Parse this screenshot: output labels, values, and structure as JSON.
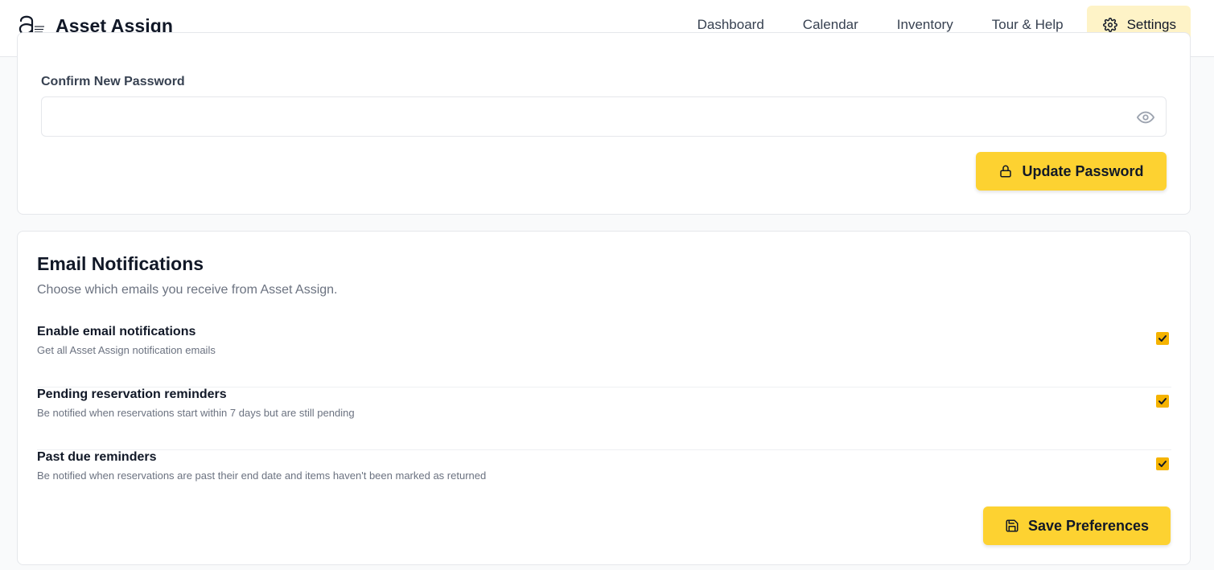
{
  "app": {
    "name": "Asset Assign",
    "logo_small_text": "asset assign"
  },
  "nav": {
    "items": [
      {
        "label": "Dashboard"
      },
      {
        "label": "Calendar"
      },
      {
        "label": "Inventory"
      },
      {
        "label": "Tour & Help"
      }
    ],
    "active": {
      "label": "Settings",
      "icon": "gear-icon"
    }
  },
  "password": {
    "confirm_label": "Confirm New Password",
    "confirm_value": "",
    "toggle_icon": "eye-icon",
    "update_button": "Update Password",
    "update_icon": "lock-icon"
  },
  "email": {
    "title": "Email Notifications",
    "subtitle": "Choose which emails you receive from Asset Assign.",
    "preferences": [
      {
        "title": "Enable email notifications",
        "description": "Get all Asset Assign notification emails",
        "checked": true
      },
      {
        "title": "Pending reservation reminders",
        "description": "Be notified when reservations start within 7 days but are still pending",
        "checked": true
      },
      {
        "title": "Past due reminders",
        "description": "Be notified when reservations are past their end date and items haven't been marked as returned",
        "checked": true
      }
    ],
    "save_button": "Save Preferences",
    "save_icon": "save-icon"
  },
  "colors": {
    "accent": "#fdd231",
    "checkbox": "#f5b300",
    "active_nav_bg": "#fef3c7"
  }
}
